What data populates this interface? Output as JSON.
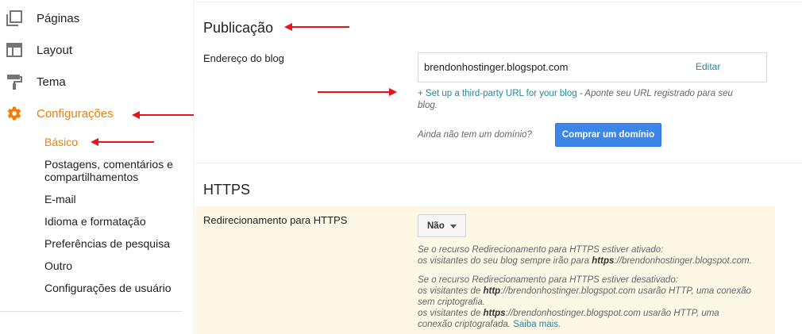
{
  "sidebar": {
    "items": [
      {
        "label": "Páginas",
        "icon": "pages-icon"
      },
      {
        "label": "Layout",
        "icon": "layout-icon"
      },
      {
        "label": "Tema",
        "icon": "theme-paint-roller-icon"
      },
      {
        "label": "Configurações",
        "icon": "gear-icon",
        "active": true
      }
    ],
    "subitems": [
      {
        "label": "Básico",
        "active": true
      },
      {
        "label": "Postagens, comentários e"
      },
      {
        "label": "compartilhamentos"
      },
      {
        "label": "E-mail"
      },
      {
        "label": "Idioma e formatação"
      },
      {
        "label": "Preferências de pesquisa"
      },
      {
        "label": "Outro"
      },
      {
        "label": "Configurações de usuário"
      }
    ]
  },
  "publicacao": {
    "title": "Publicação",
    "blog_address_label": "Endereço do blog",
    "blog_url": "brendonhostinger.blogspot.com",
    "edit_label": "Editar",
    "third_party_link": "+ Set up a third-party URL for your blog",
    "third_party_hint_1": " - Aponte seu URL registrado para seu",
    "third_party_hint_2": "blog.",
    "no_domain_text": "Ainda não tem um domínio?",
    "buy_domain_button": "Comprar um domínio"
  },
  "https": {
    "title": "HTTPS",
    "redirect_label": "Redirecionamento para HTTPS",
    "select_value": "Não",
    "on_line_1": "Se o recurso Redirecionamento para HTTPS estiver ativado:",
    "on_line_2_pre": "os visitantes do seu blog sempre irão para ",
    "on_line_2_bold": "https",
    "on_line_2_post": "://brendonhostinger.blogspot.com.",
    "off_line_1": "Se o recurso Redirecionamento para HTTPS estiver desativado:",
    "off_line_2_pre": "os visitantes de ",
    "off_line_2_bold": "http",
    "off_line_2_post": "://brendonhostinger.blogspot.com usarão HTTP, uma conexão",
    "off_line_3": "sem criptografia.",
    "off_line_4_pre": "os visitantes de ",
    "off_line_4_bold": "https",
    "off_line_4_post": "://brendonhostinger.blogspot.com usarão HTTP, uma",
    "off_line_5_pre": "conexão criptografada. ",
    "learn_more": "Saiba mais",
    "off_line_5_post": "."
  },
  "colors": {
    "accent": "#f57d00",
    "link": "#26889a",
    "button": "#3b86e8",
    "annotation_arrow": "#e8141b",
    "https_panel": "#fdf7e6"
  }
}
